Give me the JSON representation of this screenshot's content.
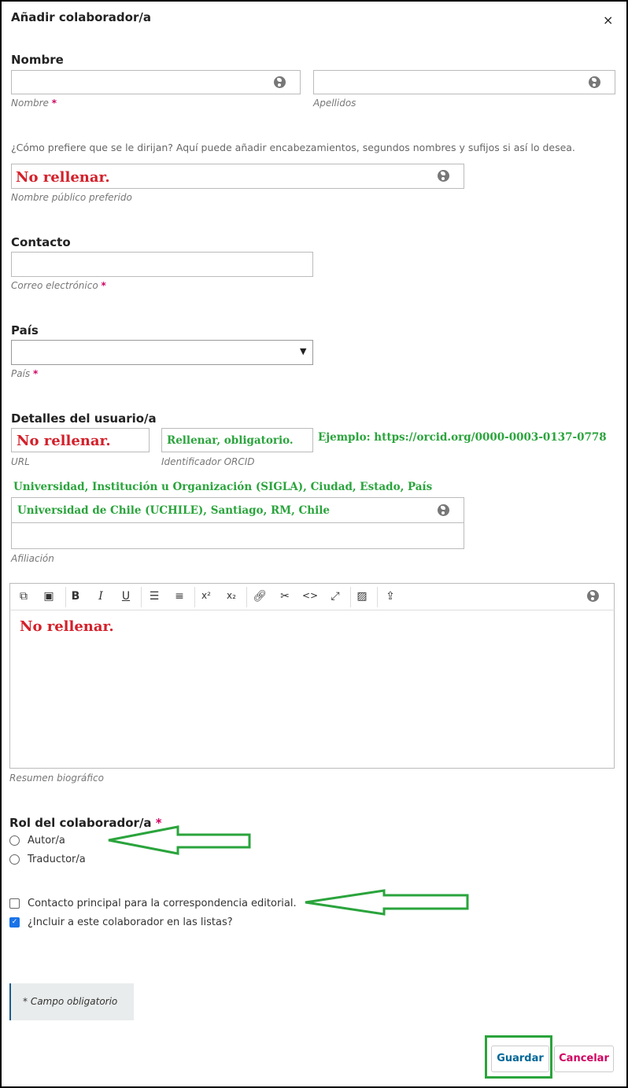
{
  "dialog": {
    "title": "Añadir colaborador/a",
    "close": "×"
  },
  "name_section": {
    "heading": "Nombre",
    "first_name": {
      "value": "",
      "label": "Nombre",
      "required": "*"
    },
    "last_name": {
      "value": "",
      "label": "Apellidos"
    },
    "help_text": "¿Cómo prefiere que se le dirijan? Aquí puede añadir encabezamientos, segundos nombres y sufijos si así lo desea.",
    "public_name": {
      "value": "No rellenar.",
      "label": "Nombre público preferido"
    }
  },
  "contact_section": {
    "heading": "Contacto",
    "email": {
      "value": "",
      "label": "Correo electrónico",
      "required": "*"
    }
  },
  "country_section": {
    "heading": "País",
    "country": {
      "value": "",
      "label": "País",
      "required": "*"
    }
  },
  "user_details": {
    "heading": "Detalles del usuario/a",
    "url": {
      "value": "No rellenar.",
      "label": "URL"
    },
    "orcid": {
      "value": "Rellenar, obligatorio.",
      "label": "Identificador ORCID"
    },
    "orcid_example": "Ejemplo: https://orcid.org/0000-0003-0137-0778",
    "affiliation_hint": "Universidad, Institución u Organización (SIGLA), Ciudad, Estado, País",
    "affiliation": {
      "value": "Universidad de Chile (UCHILE), Santiago, RM, Chile",
      "value2": "",
      "label": "Afiliación"
    }
  },
  "bio": {
    "toolbar": [
      "copy-icon",
      "paste-icon",
      "bold-icon",
      "italic-icon",
      "underline-icon",
      "bullet-list-icon",
      "numbered-list-icon",
      "superscript-icon",
      "subscript-icon",
      "link-icon",
      "unlink-icon",
      "code-icon",
      "fullscreen-icon",
      "image-icon",
      "upload-icon"
    ],
    "toolbar_glyphs": {
      "bold": "B",
      "italic": "I",
      "underline": "U",
      "superscript": "x²",
      "subscript": "x₂",
      "code": "<>"
    },
    "content": "No rellenar.",
    "label": "Resumen biográfico"
  },
  "role": {
    "heading": "Rol del colaborador/a",
    "required": "*",
    "options": [
      "Autor/a",
      "Traductor/a"
    ]
  },
  "checkboxes": {
    "primary_contact": {
      "label": "Contacto principal para la correspondencia editorial.",
      "checked": false
    },
    "include_in_lists": {
      "label": "¿Incluir a este colaborador en las listas?",
      "checked": true
    }
  },
  "required_note": "* Campo obligatorio",
  "buttons": {
    "save": "Guardar",
    "cancel": "Cancelar"
  },
  "colors": {
    "accent": "#006798",
    "required": "#d00060",
    "annotation_red": "#d3202a",
    "annotation_green": "#2aa43c"
  }
}
